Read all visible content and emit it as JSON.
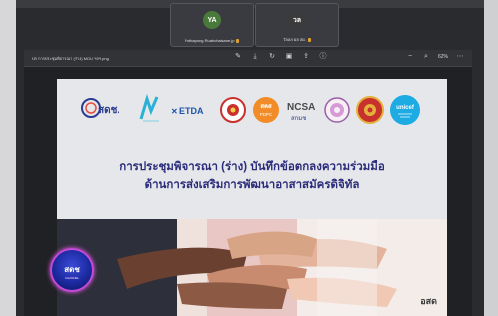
{
  "participants": [
    {
      "initials": "YA",
      "name": "Yothapong Ruahchaisane.jp",
      "avatar_color": "#4a7a3b"
    },
    {
      "initials": "วล",
      "name": "วัลลภ ผล สผ.",
      "avatar_color": "#3b3b3b"
    }
  ],
  "viewer": {
    "filename": "ปก การประชุมพิจารณา (ร่าง) MOU ฯลฯ.png",
    "zoom": "62%",
    "tool_icons": [
      "edit-icon",
      "download-icon",
      "lock-icon",
      "share-icon",
      "search-icon",
      "more-icon"
    ]
  },
  "slide": {
    "logos": {
      "sdch": "สดช.",
      "etda": "ETDA",
      "pdpc_top": "สคส",
      "pdpc_bottom": "PDPC",
      "ncsa_top": "NCSA",
      "ncsa_bottom": "สกมช",
      "unicef": "unicef"
    },
    "title_line1": "การประชุมพิจารณา (ร่าง) บันทึกข้อตกลงความร่วมมือ",
    "title_line2": "ด้านการส่งเสริมการพัฒนาอาสาสมัครดิจิทัล",
    "photo_logo": "อสด"
  },
  "badge": {
    "text": "สดช",
    "subtext": "CHANNEL"
  },
  "colors": {
    "title": "#2c2d7a",
    "sdch_blue": "#2b3d91",
    "pdpc_orange": "#f28c28",
    "unicef_blue": "#1cabe2"
  }
}
